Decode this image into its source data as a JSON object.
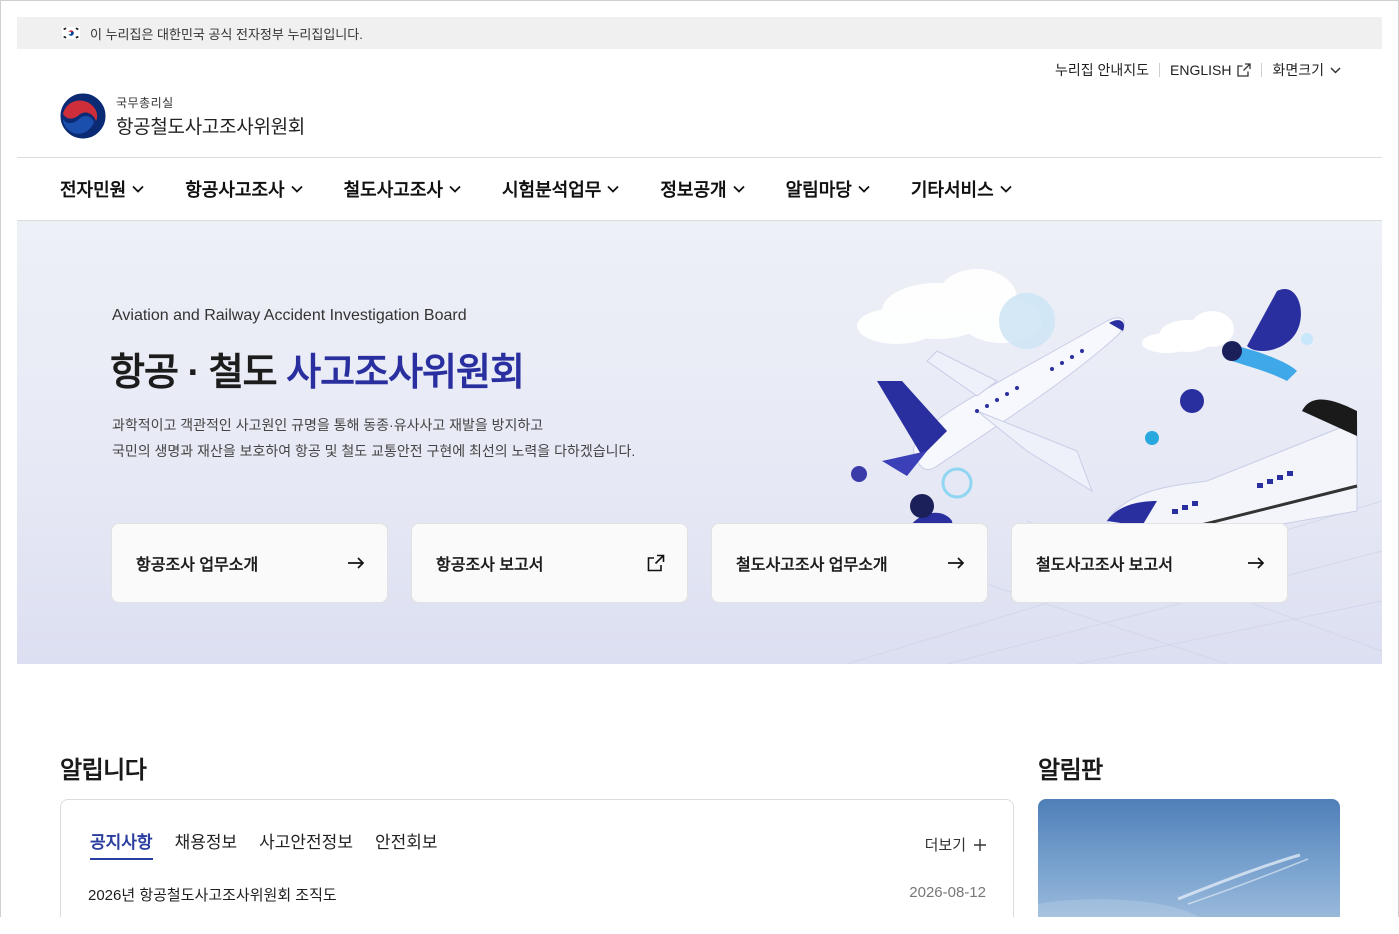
{
  "gov_banner": {
    "text": "이 누리집은 대한민국 공식 전자정부 누리집입니다."
  },
  "utility": {
    "sitemap": "누리집 안내지도",
    "english": "ENGLISH",
    "zoom": "화면크기"
  },
  "logo": {
    "ministry": "국무총리실",
    "org": "항공철도사고조사위원회"
  },
  "nav": [
    {
      "label": "전자민원"
    },
    {
      "label": "항공사고조사"
    },
    {
      "label": "철도사고조사"
    },
    {
      "label": "시험분석업무"
    },
    {
      "label": "정보공개"
    },
    {
      "label": "알림마당"
    },
    {
      "label": "기타서비스"
    }
  ],
  "hero": {
    "eng": "Aviation and Railway Accident Investigation Board",
    "title_plain": "항공 · 철도",
    "title_accent": "사고조사위원회",
    "desc_line1": "과학적이고 객관적인 사고원인 규명을 통해 동종·유사사고 재발을 방지하고",
    "desc_line2": "국민의 생명과 재산을 보호하여 항공 및 철도 교통안전 구현에 최선의 노력을 다하겠습니다."
  },
  "cards": [
    {
      "label": "항공조사 업무소개",
      "icon": "arrow-right-icon"
    },
    {
      "label": "항공조사 보고서",
      "icon": "external-link-icon"
    },
    {
      "label": "철도사고조사 업무소개",
      "icon": "arrow-right-icon"
    },
    {
      "label": "철도사고조사 보고서",
      "icon": "arrow-right-icon"
    }
  ],
  "notices": {
    "title": "알립니다",
    "tabs": [
      "공지사항",
      "채용정보",
      "사고안전정보",
      "안전회보"
    ],
    "more": "더보기",
    "items": [
      {
        "title": "2026년 항공철도사고조사위원회 조직도",
        "date": "2026-08-12"
      }
    ]
  },
  "board": {
    "title": "알림판"
  },
  "colors": {
    "accent": "#2a2fa0",
    "hero_bg": "#e6e8f5",
    "tab_active": "#2a3ea0"
  }
}
